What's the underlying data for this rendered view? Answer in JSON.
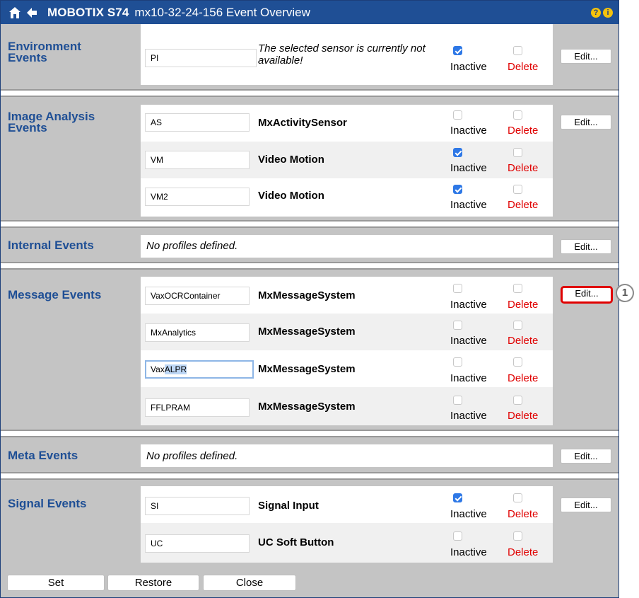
{
  "titlebar": {
    "title": "MOBOTIX S74",
    "subtitle": "mx10-32-24-156 Event Overview",
    "help_glyph": "?",
    "info_glyph": "i"
  },
  "labels": {
    "inactive": "Inactive",
    "delete": "Delete",
    "edit": "Edit...",
    "no_profiles": "No profiles defined."
  },
  "sections": {
    "environment": {
      "title_line1": "Environment",
      "title_line2": "Events",
      "rows": [
        {
          "name": "PI",
          "desc_line1": "The selected sensor is currently not",
          "desc_line2": "available!",
          "inactive": true,
          "delete": false
        }
      ]
    },
    "image_analysis": {
      "title_line1": "Image Analysis",
      "title_line2": "Events",
      "rows": [
        {
          "name": "AS",
          "desc": "MxActivitySensor",
          "inactive": false,
          "delete": false
        },
        {
          "name": "VM",
          "desc": "Video Motion",
          "inactive": true,
          "delete": false
        },
        {
          "name": "VM2",
          "desc": "Video Motion",
          "inactive": true,
          "delete": false
        }
      ]
    },
    "internal": {
      "title": "Internal Events"
    },
    "message": {
      "title": "Message Events",
      "rows": [
        {
          "name": "VaxOCRContainer",
          "desc": "MxMessageSystem",
          "inactive": false,
          "delete": false
        },
        {
          "name": "MxAnalytics",
          "desc": "MxMessageSystem",
          "inactive": false,
          "delete": false
        },
        {
          "name_part1": "Vax",
          "name_part2": "ALPR",
          "desc": "MxMessageSystem",
          "inactive": false,
          "delete": false
        },
        {
          "name": "FFLPRAM",
          "desc": "MxMessageSystem",
          "inactive": false,
          "delete": false
        }
      ]
    },
    "meta": {
      "title": "Meta Events"
    },
    "signal": {
      "title": "Signal Events",
      "rows": [
        {
          "name": "SI",
          "desc": "Signal Input",
          "inactive": true,
          "delete": false
        },
        {
          "name": "UC",
          "desc": "UC Soft Button",
          "inactive": false,
          "delete": false
        }
      ]
    }
  },
  "callout": "1",
  "footer": {
    "set": "Set",
    "restore": "Restore",
    "close": "Close"
  },
  "colors": {
    "header": "#1f4f95",
    "section_title": "#1f4f95",
    "delete": "#e00000",
    "checked": "#2e78e6",
    "highlight": "#e00000"
  }
}
